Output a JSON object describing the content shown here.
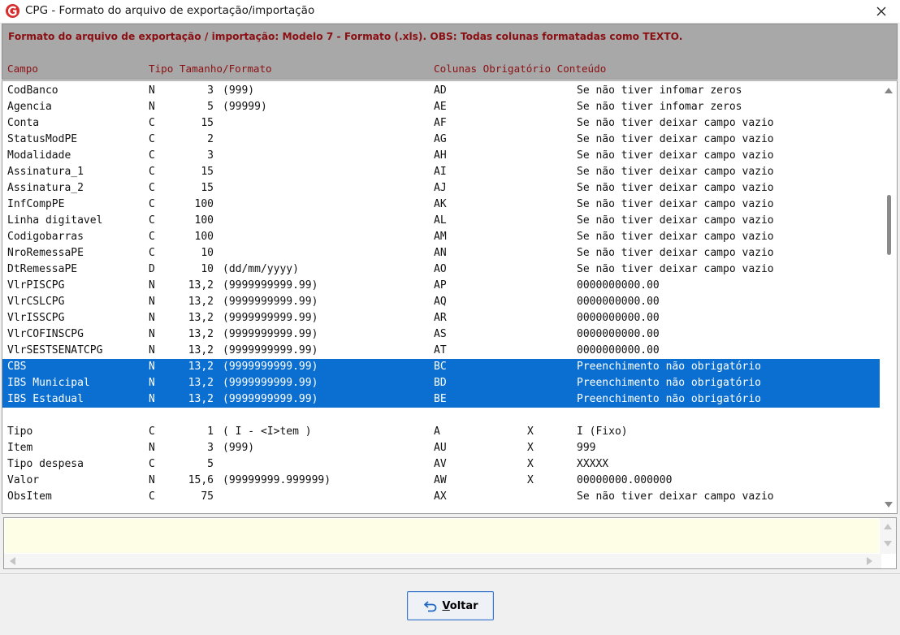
{
  "window": {
    "title": "CPG - Formato do arquivo de exportação/importação",
    "close_glyph": "✕",
    "icon": "app-logo-icon",
    "accent_color": "#8b0f12"
  },
  "header": {
    "description": "Formato do arquivo de exportação / importação: Modelo 7 - Formato (.xls). OBS: Todas colunas formatadas como TEXTO.",
    "columns": {
      "campo": "Campo",
      "tipo_tamanho_formato": "Tipo Tamanho/Formato",
      "colunas_obrigatorio_conteudo": "Colunas Obrigatório Conteúdo"
    }
  },
  "rows": [
    {
      "campo": "CodBanco",
      "tipo": "N",
      "tamanho": "3",
      "formato": "(999)",
      "coluna": "AD",
      "obrigatorio": "",
      "conteudo": "Se não tiver infomar zeros",
      "selected": false
    },
    {
      "campo": "Agencia",
      "tipo": "N",
      "tamanho": "5",
      "formato": "(99999)",
      "coluna": "AE",
      "obrigatorio": "",
      "conteudo": "Se não tiver infomar zeros",
      "selected": false
    },
    {
      "campo": "Conta",
      "tipo": "C",
      "tamanho": "15",
      "formato": "",
      "coluna": "AF",
      "obrigatorio": "",
      "conteudo": "Se não tiver deixar campo vazio",
      "selected": false
    },
    {
      "campo": "StatusModPE",
      "tipo": "C",
      "tamanho": "2",
      "formato": "",
      "coluna": "AG",
      "obrigatorio": "",
      "conteudo": "Se não tiver deixar campo vazio",
      "selected": false
    },
    {
      "campo": "Modalidade",
      "tipo": "C",
      "tamanho": "3",
      "formato": "",
      "coluna": "AH",
      "obrigatorio": "",
      "conteudo": "Se não tiver deixar campo vazio",
      "selected": false
    },
    {
      "campo": "Assinatura_1",
      "tipo": "C",
      "tamanho": "15",
      "formato": "",
      "coluna": "AI",
      "obrigatorio": "",
      "conteudo": "Se não tiver deixar campo vazio",
      "selected": false
    },
    {
      "campo": "Assinatura_2",
      "tipo": "C",
      "tamanho": "15",
      "formato": "",
      "coluna": "AJ",
      "obrigatorio": "",
      "conteudo": "Se não tiver deixar campo vazio",
      "selected": false
    },
    {
      "campo": "InfCompPE",
      "tipo": "C",
      "tamanho": "100",
      "formato": "",
      "coluna": "AK",
      "obrigatorio": "",
      "conteudo": "Se não tiver deixar campo vazio",
      "selected": false
    },
    {
      "campo": "Linha digitavel",
      "tipo": "C",
      "tamanho": "100",
      "formato": "",
      "coluna": "AL",
      "obrigatorio": "",
      "conteudo": "Se não tiver deixar campo vazio",
      "selected": false
    },
    {
      "campo": "Codigobarras",
      "tipo": "C",
      "tamanho": "100",
      "formato": "",
      "coluna": "AM",
      "obrigatorio": "",
      "conteudo": "Se não tiver deixar campo vazio",
      "selected": false
    },
    {
      "campo": "NroRemessaPE",
      "tipo": "C",
      "tamanho": "10",
      "formato": "",
      "coluna": "AN",
      "obrigatorio": "",
      "conteudo": "Se não tiver deixar campo vazio",
      "selected": false
    },
    {
      "campo": "DtRemessaPE",
      "tipo": "D",
      "tamanho": "10",
      "formato": "(dd/mm/yyyy)",
      "coluna": "AO",
      "obrigatorio": "",
      "conteudo": "Se não tiver deixar campo vazio",
      "selected": false
    },
    {
      "campo": "VlrPISCPG",
      "tipo": "N",
      "tamanho": "13,2",
      "formato": "(9999999999.99)",
      "coluna": "AP",
      "obrigatorio": "",
      "conteudo": "0000000000.00",
      "selected": false
    },
    {
      "campo": "VlrCSLCPG",
      "tipo": "N",
      "tamanho": "13,2",
      "formato": "(9999999999.99)",
      "coluna": "AQ",
      "obrigatorio": "",
      "conteudo": "0000000000.00",
      "selected": false
    },
    {
      "campo": "VlrISSCPG",
      "tipo": "N",
      "tamanho": "13,2",
      "formato": "(9999999999.99)",
      "coluna": "AR",
      "obrigatorio": "",
      "conteudo": "0000000000.00",
      "selected": false
    },
    {
      "campo": "VlrCOFINSCPG",
      "tipo": "N",
      "tamanho": "13,2",
      "formato": "(9999999999.99)",
      "coluna": "AS",
      "obrigatorio": "",
      "conteudo": "0000000000.00",
      "selected": false
    },
    {
      "campo": "VlrSESTSENATCPG",
      "tipo": "N",
      "tamanho": "13,2",
      "formato": "(9999999999.99)",
      "coluna": "AT",
      "obrigatorio": "",
      "conteudo": "0000000000.00",
      "selected": false
    },
    {
      "campo": "CBS",
      "tipo": "N",
      "tamanho": "13,2",
      "formato": "(9999999999.99)",
      "coluna": "BC",
      "obrigatorio": "",
      "conteudo": "Preenchimento não obrigatório",
      "selected": true
    },
    {
      "campo": "IBS Municipal",
      "tipo": "N",
      "tamanho": "13,2",
      "formato": "(9999999999.99)",
      "coluna": "BD",
      "obrigatorio": "",
      "conteudo": "Preenchimento não obrigatório",
      "selected": true
    },
    {
      "campo": "IBS Estadual",
      "tipo": "N",
      "tamanho": "13,2",
      "formato": "(9999999999.99)",
      "coluna": "BE",
      "obrigatorio": "",
      "conteudo": "Preenchimento não obrigatório",
      "selected": true
    },
    {
      "campo": "",
      "tipo": "",
      "tamanho": "",
      "formato": "",
      "coluna": "",
      "obrigatorio": "",
      "conteudo": "",
      "selected": false
    },
    {
      "campo": "Tipo",
      "tipo": "C",
      "tamanho": "1",
      "formato": "( I - <I>tem )",
      "coluna": "A",
      "obrigatorio": "X",
      "conteudo": "I (Fixo)",
      "selected": false
    },
    {
      "campo": "Item",
      "tipo": "N",
      "tamanho": "3",
      "formato": "(999)",
      "coluna": "AU",
      "obrigatorio": "X",
      "conteudo": "999",
      "selected": false
    },
    {
      "campo": "Tipo despesa",
      "tipo": "C",
      "tamanho": "5",
      "formato": "",
      "coluna": "AV",
      "obrigatorio": "X",
      "conteudo": "XXXXX",
      "selected": false
    },
    {
      "campo": "Valor",
      "tipo": "N",
      "tamanho": "15,6",
      "formato": "(99999999.999999)",
      "coluna": "AW",
      "obrigatorio": "X",
      "conteudo": "00000000.000000",
      "selected": false
    },
    {
      "campo": "ObsItem",
      "tipo": "C",
      "tamanho": "75",
      "formato": "",
      "coluna": "AX",
      "obrigatorio": "",
      "conteudo": "Se não tiver deixar campo vazio",
      "selected": false
    }
  ],
  "memo": {
    "value": ""
  },
  "footer": {
    "back_label": "Voltar",
    "back_icon": "undo-arrow-icon"
  }
}
